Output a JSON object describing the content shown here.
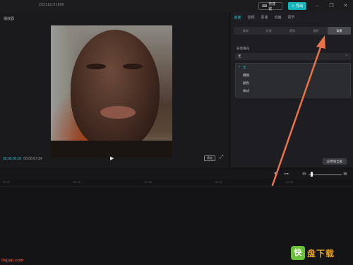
{
  "titlebar": {
    "title": "202111161806",
    "shortcut_label": "快捷键",
    "export_label": "导出"
  },
  "player": {
    "label": "播放器",
    "current_time": "00:00:00:00",
    "total_time": "00:00:07:34",
    "ratio_label": "原始"
  },
  "panel": {
    "tabs": [
      "画面",
      "音频",
      "变速",
      "动画",
      "调节"
    ],
    "active_tab": 0,
    "subtabs": [
      "基础",
      "抠像",
      "蒙版",
      "美颜",
      "背景"
    ],
    "active_subtab": 4,
    "section_title": "背景填充",
    "select_value": "无",
    "options": [
      "无",
      "模糊",
      "颜色",
      "样式"
    ],
    "selected_option": 0,
    "apply_label": "应用到全部"
  },
  "ruler": {
    "ticks": [
      "00:00",
      "00:10",
      "00:15",
      "00:20",
      "00:25"
    ]
  },
  "watermark": "lixpan.com",
  "logo": {
    "mark": "快",
    "text": "盘下载"
  },
  "colors": {
    "accent": "#2db7c4",
    "export_button": "#17b3b9",
    "arrow": "#e8724a",
    "logo_green": "#6cc13a",
    "logo_orange": "#e8a21b"
  }
}
